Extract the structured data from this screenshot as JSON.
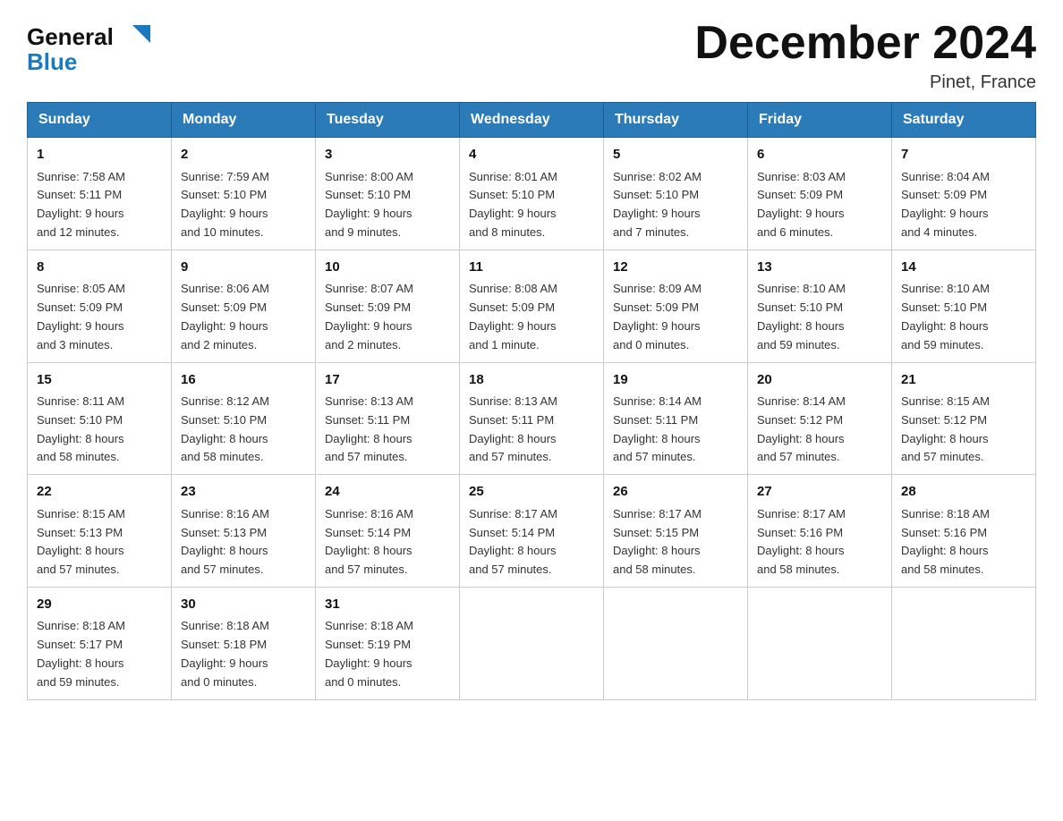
{
  "logo": {
    "general": "General",
    "blue": "Blue",
    "arrow_color": "#1a7abf"
  },
  "header": {
    "title": "December 2024",
    "location": "Pinet, France"
  },
  "days_of_week": [
    "Sunday",
    "Monday",
    "Tuesday",
    "Wednesday",
    "Thursday",
    "Friday",
    "Saturday"
  ],
  "weeks": [
    [
      {
        "day": "1",
        "info": "Sunrise: 7:58 AM\nSunset: 5:11 PM\nDaylight: 9 hours\nand 12 minutes."
      },
      {
        "day": "2",
        "info": "Sunrise: 7:59 AM\nSunset: 5:10 PM\nDaylight: 9 hours\nand 10 minutes."
      },
      {
        "day": "3",
        "info": "Sunrise: 8:00 AM\nSunset: 5:10 PM\nDaylight: 9 hours\nand 9 minutes."
      },
      {
        "day": "4",
        "info": "Sunrise: 8:01 AM\nSunset: 5:10 PM\nDaylight: 9 hours\nand 8 minutes."
      },
      {
        "day": "5",
        "info": "Sunrise: 8:02 AM\nSunset: 5:10 PM\nDaylight: 9 hours\nand 7 minutes."
      },
      {
        "day": "6",
        "info": "Sunrise: 8:03 AM\nSunset: 5:09 PM\nDaylight: 9 hours\nand 6 minutes."
      },
      {
        "day": "7",
        "info": "Sunrise: 8:04 AM\nSunset: 5:09 PM\nDaylight: 9 hours\nand 4 minutes."
      }
    ],
    [
      {
        "day": "8",
        "info": "Sunrise: 8:05 AM\nSunset: 5:09 PM\nDaylight: 9 hours\nand 3 minutes."
      },
      {
        "day": "9",
        "info": "Sunrise: 8:06 AM\nSunset: 5:09 PM\nDaylight: 9 hours\nand 2 minutes."
      },
      {
        "day": "10",
        "info": "Sunrise: 8:07 AM\nSunset: 5:09 PM\nDaylight: 9 hours\nand 2 minutes."
      },
      {
        "day": "11",
        "info": "Sunrise: 8:08 AM\nSunset: 5:09 PM\nDaylight: 9 hours\nand 1 minute."
      },
      {
        "day": "12",
        "info": "Sunrise: 8:09 AM\nSunset: 5:09 PM\nDaylight: 9 hours\nand 0 minutes."
      },
      {
        "day": "13",
        "info": "Sunrise: 8:10 AM\nSunset: 5:10 PM\nDaylight: 8 hours\nand 59 minutes."
      },
      {
        "day": "14",
        "info": "Sunrise: 8:10 AM\nSunset: 5:10 PM\nDaylight: 8 hours\nand 59 minutes."
      }
    ],
    [
      {
        "day": "15",
        "info": "Sunrise: 8:11 AM\nSunset: 5:10 PM\nDaylight: 8 hours\nand 58 minutes."
      },
      {
        "day": "16",
        "info": "Sunrise: 8:12 AM\nSunset: 5:10 PM\nDaylight: 8 hours\nand 58 minutes."
      },
      {
        "day": "17",
        "info": "Sunrise: 8:13 AM\nSunset: 5:11 PM\nDaylight: 8 hours\nand 57 minutes."
      },
      {
        "day": "18",
        "info": "Sunrise: 8:13 AM\nSunset: 5:11 PM\nDaylight: 8 hours\nand 57 minutes."
      },
      {
        "day": "19",
        "info": "Sunrise: 8:14 AM\nSunset: 5:11 PM\nDaylight: 8 hours\nand 57 minutes."
      },
      {
        "day": "20",
        "info": "Sunrise: 8:14 AM\nSunset: 5:12 PM\nDaylight: 8 hours\nand 57 minutes."
      },
      {
        "day": "21",
        "info": "Sunrise: 8:15 AM\nSunset: 5:12 PM\nDaylight: 8 hours\nand 57 minutes."
      }
    ],
    [
      {
        "day": "22",
        "info": "Sunrise: 8:15 AM\nSunset: 5:13 PM\nDaylight: 8 hours\nand 57 minutes."
      },
      {
        "day": "23",
        "info": "Sunrise: 8:16 AM\nSunset: 5:13 PM\nDaylight: 8 hours\nand 57 minutes."
      },
      {
        "day": "24",
        "info": "Sunrise: 8:16 AM\nSunset: 5:14 PM\nDaylight: 8 hours\nand 57 minutes."
      },
      {
        "day": "25",
        "info": "Sunrise: 8:17 AM\nSunset: 5:14 PM\nDaylight: 8 hours\nand 57 minutes."
      },
      {
        "day": "26",
        "info": "Sunrise: 8:17 AM\nSunset: 5:15 PM\nDaylight: 8 hours\nand 58 minutes."
      },
      {
        "day": "27",
        "info": "Sunrise: 8:17 AM\nSunset: 5:16 PM\nDaylight: 8 hours\nand 58 minutes."
      },
      {
        "day": "28",
        "info": "Sunrise: 8:18 AM\nSunset: 5:16 PM\nDaylight: 8 hours\nand 58 minutes."
      }
    ],
    [
      {
        "day": "29",
        "info": "Sunrise: 8:18 AM\nSunset: 5:17 PM\nDaylight: 8 hours\nand 59 minutes."
      },
      {
        "day": "30",
        "info": "Sunrise: 8:18 AM\nSunset: 5:18 PM\nDaylight: 9 hours\nand 0 minutes."
      },
      {
        "day": "31",
        "info": "Sunrise: 8:18 AM\nSunset: 5:19 PM\nDaylight: 9 hours\nand 0 minutes."
      },
      {
        "day": "",
        "info": ""
      },
      {
        "day": "",
        "info": ""
      },
      {
        "day": "",
        "info": ""
      },
      {
        "day": "",
        "info": ""
      }
    ]
  ]
}
